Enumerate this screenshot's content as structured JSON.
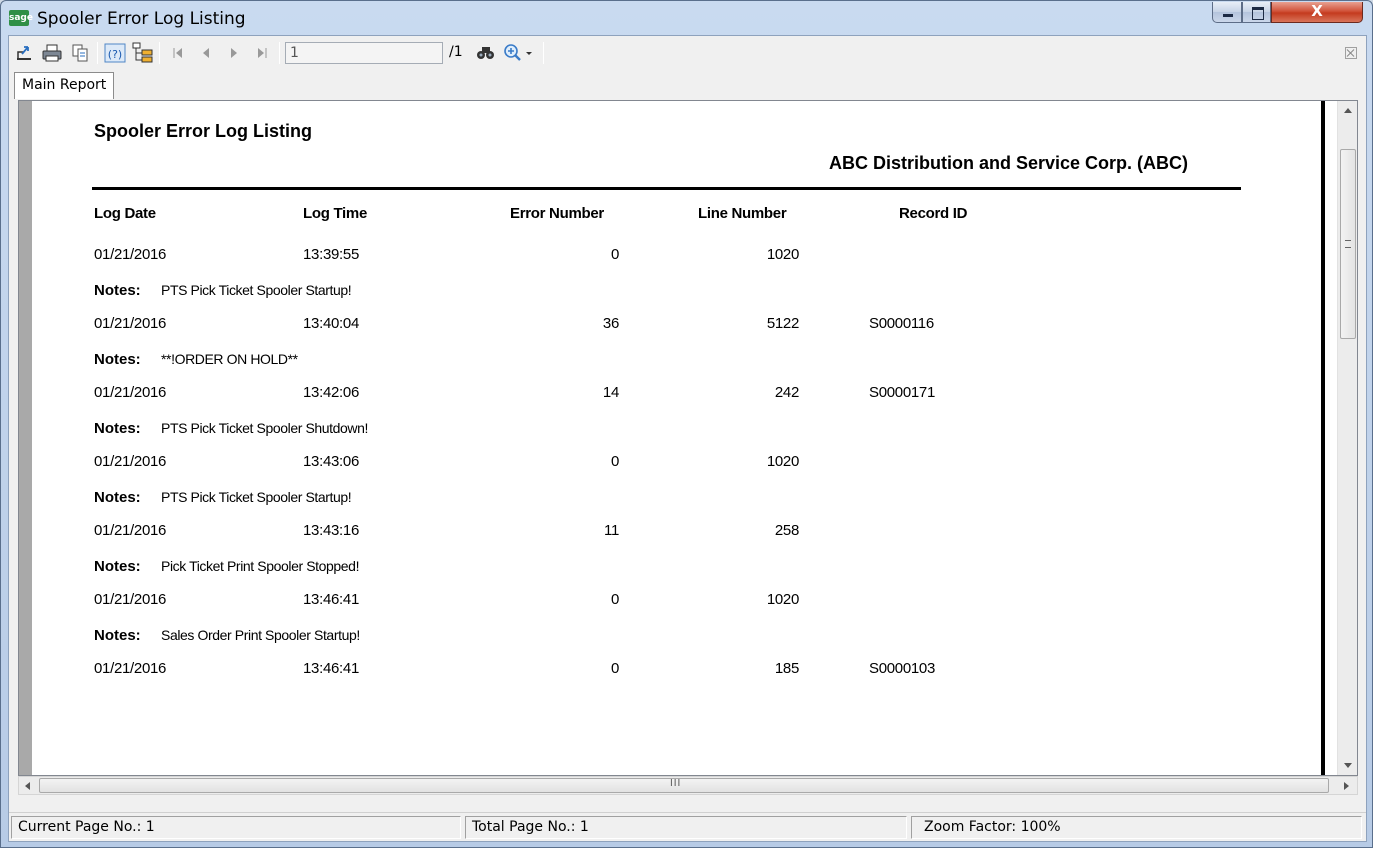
{
  "window": {
    "title": "Spooler Error Log Listing",
    "app_icon": "sage",
    "close_glyph": "X"
  },
  "toolbar": {
    "icons": [
      "export-icon",
      "print-icon",
      "copy-icon",
      "help-icon",
      "group-tree-icon",
      "first-page-icon",
      "previous-page-icon",
      "next-page-icon",
      "last-page-icon",
      "find-icon",
      "zoom-icon"
    ],
    "page_value": "1",
    "page_total": "/1"
  },
  "tabs": [
    {
      "label": "Main Report"
    }
  ],
  "report": {
    "title": "Spooler Error Log Listing",
    "company": "ABC Distribution and Service Corp. (ABC)",
    "columns": {
      "log_date": "Log Date",
      "log_time": "Log Time",
      "error_number": "Error Number",
      "line_number": "Line Number",
      "record_id": "Record ID"
    },
    "notes_label": "Notes:",
    "rows": [
      {
        "date": "01/21/2016",
        "time": "13:39:55",
        "error": "0",
        "line": "1020",
        "record": "",
        "notes": "PTS Pick Ticket Spooler Startup!"
      },
      {
        "date": "01/21/2016",
        "time": "13:40:04",
        "error": "36",
        "line": "5122",
        "record": "S0000116",
        "notes": "**!ORDER ON HOLD**"
      },
      {
        "date": "01/21/2016",
        "time": "13:42:06",
        "error": "14",
        "line": "242",
        "record": "S0000171",
        "notes": "PTS Pick Ticket Spooler Shutdown!"
      },
      {
        "date": "01/21/2016",
        "time": "13:43:06",
        "error": "0",
        "line": "1020",
        "record": "",
        "notes": "PTS Pick Ticket Spooler Startup!"
      },
      {
        "date": "01/21/2016",
        "time": "13:43:16",
        "error": "11",
        "line": "258",
        "record": "",
        "notes": "Pick Ticket Print Spooler Stopped!"
      },
      {
        "date": "01/21/2016",
        "time": "13:46:41",
        "error": "0",
        "line": "1020",
        "record": "",
        "notes": "Sales Order Print Spooler Startup!"
      },
      {
        "date": "01/21/2016",
        "time": "13:46:41",
        "error": "0",
        "line": "185",
        "record": "S0000103",
        "notes": ""
      }
    ]
  },
  "hscroll_grip": "III",
  "status": {
    "current_page": "Current Page No.: 1",
    "total_page": "Total Page No.: 1",
    "zoom": "Zoom Factor: 100%"
  }
}
